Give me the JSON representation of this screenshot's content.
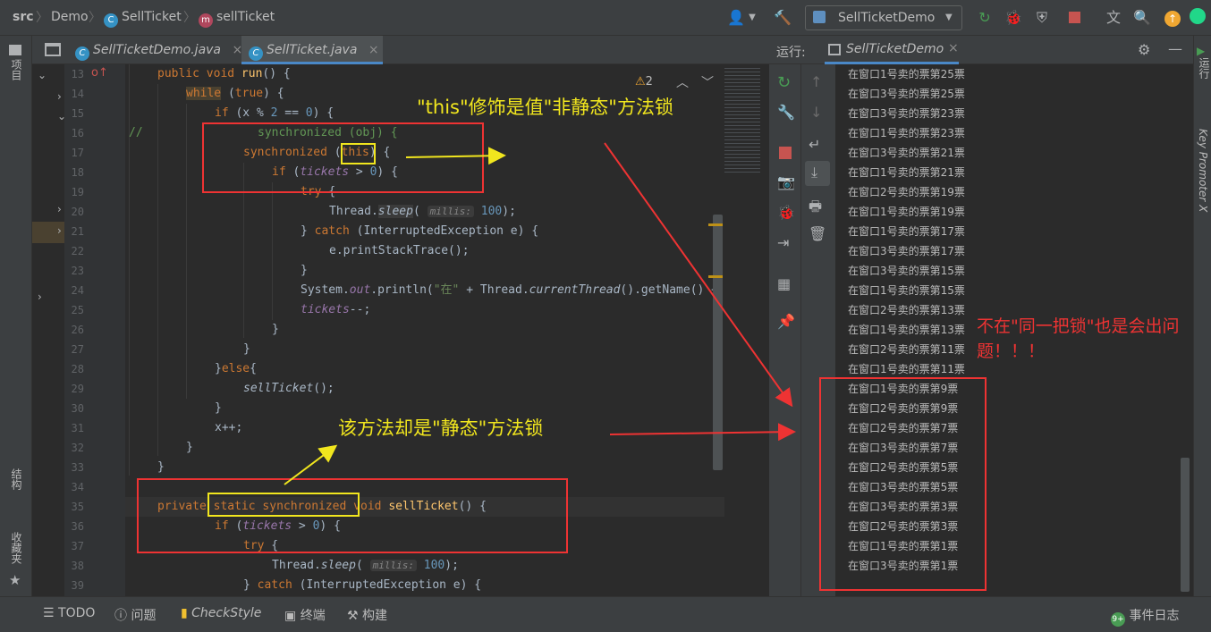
{
  "breadcrumb": {
    "src": "src",
    "demo": "Demo",
    "class": "SellTicket",
    "method": "sellTicket"
  },
  "toolbar": {
    "run_config": "SellTicketDemo"
  },
  "left_strip": {
    "project": "项目",
    "structure": "结构",
    "favorites": "收藏夹"
  },
  "editor_tabs": [
    {
      "label": "SellTicketDemo.java",
      "active": false
    },
    {
      "label": "SellTicket.java",
      "active": true
    }
  ],
  "warnings": {
    "count": "2"
  },
  "line_numbers": [
    "13",
    "14",
    "15",
    "16",
    "17",
    "18",
    "19",
    "20",
    "21",
    "22",
    "23",
    "24",
    "25",
    "26",
    "27",
    "28",
    "29",
    "30",
    "31",
    "32",
    "33",
    "34",
    "35",
    "36",
    "37",
    "38",
    "39"
  ],
  "code": {
    "l13": [
      "public void ",
      "run",
      "() {"
    ],
    "l14": [
      "while",
      " (",
      "true",
      ") {"
    ],
    "l15": [
      "if",
      " (x % ",
      "2",
      " == ",
      "0",
      ") {"
    ],
    "l16": [
      "//",
      "synchronized (obj) {"
    ],
    "l17": [
      "synchronized",
      " (",
      "this",
      ") {"
    ],
    "l18": [
      "if",
      " (",
      "tickets",
      " > ",
      "0",
      ") {"
    ],
    "l19": [
      "try",
      " {"
    ],
    "l20": [
      "Thread.",
      "sleep",
      "( ",
      "millis:",
      " 100",
      ");"
    ],
    "l21": [
      "} ",
      "catch",
      " (InterruptedException e) {"
    ],
    "l22": [
      "e.printStackTrace();"
    ],
    "l23": [
      "}"
    ],
    "l24": [
      "System.",
      "out",
      ".println(",
      "\"在\"",
      " + Thread.",
      "currentThread",
      "().getName() +"
    ],
    "l25": [
      "tickets",
      "--;"
    ],
    "l26": [
      "}"
    ],
    "l27": [
      "}"
    ],
    "l28": [
      "}",
      "else",
      "{"
    ],
    "l29": [
      "sellTicket",
      "();"
    ],
    "l30": [
      "}"
    ],
    "l31": [
      "x++;"
    ],
    "l32": [
      "}"
    ],
    "l33": [
      "}"
    ],
    "l35": [
      "private ",
      "static synchronized",
      " void ",
      "sellTicket",
      "() {"
    ],
    "l36": [
      "if",
      " (",
      "tickets",
      " > ",
      "0",
      ") {"
    ],
    "l37": [
      "try",
      " {"
    ],
    "l38": [
      "Thread.",
      "sleep",
      "( ",
      "millis:",
      " 100",
      ");"
    ],
    "l39": [
      "} ",
      "catch",
      " (InterruptedException e) {"
    ]
  },
  "run_panel": {
    "title": "运行:",
    "tab": "SellTicketDemo"
  },
  "console_lines": [
    "在窗口1号卖的票第25票",
    "在窗口3号卖的票第25票",
    "在窗口3号卖的票第23票",
    "在窗口1号卖的票第23票",
    "在窗口3号卖的票第21票",
    "在窗口1号卖的票第21票",
    "在窗口2号卖的票第19票",
    "在窗口1号卖的票第19票",
    "在窗口1号卖的票第17票",
    "在窗口3号卖的票第17票",
    "在窗口3号卖的票第15票",
    "在窗口1号卖的票第15票",
    "在窗口2号卖的票第13票",
    "在窗口1号卖的票第13票",
    "在窗口2号卖的票第11票",
    "在窗口1号卖的票第11票",
    "在窗口1号卖的票第9票",
    "在窗口2号卖的票第9票",
    "在窗口2号卖的票第7票",
    "在窗口3号卖的票第7票",
    "在窗口2号卖的票第5票",
    "在窗口3号卖的票第5票",
    "在窗口3号卖的票第3票",
    "在窗口2号卖的票第3票",
    "在窗口1号卖的票第1票",
    "在窗口3号卖的票第1票"
  ],
  "right_strip": {
    "run": "运行",
    "key_promoter": "Key Promoter X"
  },
  "annotations": {
    "this_lock": "\"this\"修饰是值\"非静态\"方法锁",
    "static_lock": "该方法却是\"静态\"方法锁",
    "same_lock_line1": "不在\"同一把锁\"也是会出问",
    "same_lock_line2": "题！！！"
  },
  "bottom_bar": {
    "todo": "TODO",
    "problems": "问题",
    "checkstyle": "CheckStyle",
    "terminal": "终端",
    "build": "构建",
    "event_log": "事件日志"
  }
}
